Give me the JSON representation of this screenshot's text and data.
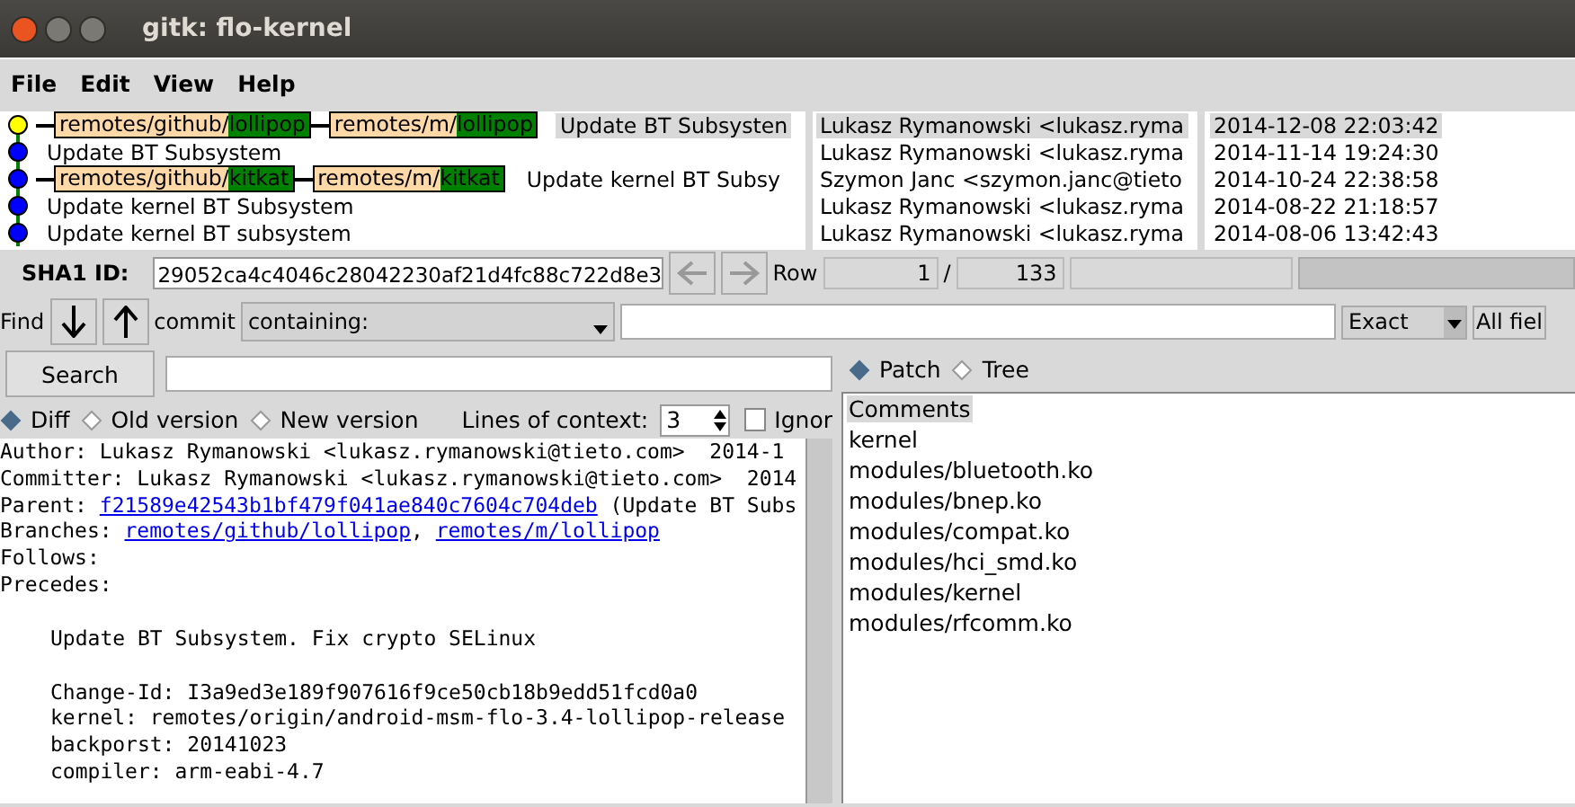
{
  "window": {
    "title": "gitk: flo-kernel"
  },
  "menu": [
    "File",
    "Edit",
    "View",
    "Help"
  ],
  "commits": [
    {
      "selected": true,
      "color": "#ffff00",
      "refs": [
        {
          "prefix": "remotes/github/",
          "name": "lollipop"
        },
        {
          "prefix": "remotes/m/",
          "name": "lollipop"
        }
      ],
      "subject": "Update BT Subsysten",
      "author": "Lukasz Rymanowski <lukasz.ryma",
      "date": "2014-12-08 22:03:42"
    },
    {
      "selected": false,
      "color": "#0000ff",
      "subject": "Update BT Subsystem",
      "author": "Lukasz Rymanowski <lukasz.ryma",
      "date": "2014-11-14 19:24:30"
    },
    {
      "selected": false,
      "color": "#0000ff",
      "refs": [
        {
          "prefix": "remotes/github/",
          "name": "kitkat"
        },
        {
          "prefix": "remotes/m/",
          "name": "kitkat"
        }
      ],
      "subject": "Update kernel BT Subsy",
      "author": "Szymon Janc <szymon.janc@tieto",
      "date": "2014-10-24 22:38:58"
    },
    {
      "selected": false,
      "color": "#0000ff",
      "subject": "Update kernel BT Subsystem",
      "author": "Lukasz Rymanowski <lukasz.ryma",
      "date": "2014-08-22 21:18:57"
    },
    {
      "selected": false,
      "color": "#0000ff",
      "subject": "Update kernel BT subsystem",
      "author": "Lukasz Rymanowski <lukasz.ryma",
      "date": "2014-08-06 13:42:43"
    }
  ],
  "sha1": {
    "label": "SHA1 ID:",
    "value": "29052ca4c4046c28042230af21d4fc88c722d8e3",
    "row_label": "Row",
    "row": "1",
    "separator": "/",
    "total": "133"
  },
  "find": {
    "label": "Find",
    "type_label": "commit",
    "mode": "containing:",
    "match": "Exact",
    "fields": "All fiel"
  },
  "search": {
    "button": "Search"
  },
  "view_modes": [
    {
      "label": "Diff",
      "selected": true
    },
    {
      "label": "Old version",
      "selected": false
    },
    {
      "label": "New version",
      "selected": false
    }
  ],
  "context": {
    "label": "Lines of context:",
    "value": "3"
  },
  "ignore": {
    "label": "Ignor",
    "checked": false
  },
  "file_modes": [
    {
      "label": "Patch",
      "selected": true
    },
    {
      "label": "Tree",
      "selected": false
    }
  ],
  "header": [
    [
      {
        "kind": "text",
        "text": "Author: Lukasz Rymanowski <lukasz.rymanowski@tieto.com>  2014-1"
      }
    ],
    [
      {
        "kind": "text",
        "text": "Committer: Lukasz Rymanowski <lukasz.rymanowski@tieto.com>  2014"
      }
    ],
    [
      {
        "kind": "text",
        "text": "Parent: "
      },
      {
        "kind": "link",
        "text": "f21589e42543b1bf479f041ae840c7604c704deb"
      },
      {
        "kind": "text",
        "text": " (Update BT Subs"
      }
    ],
    [
      {
        "kind": "text",
        "text": "Branches: "
      },
      {
        "kind": "link",
        "text": "remotes/github/lollipop"
      },
      {
        "kind": "text",
        "text": ", "
      },
      {
        "kind": "link",
        "text": "remotes/m/lollipop"
      }
    ],
    [
      {
        "kind": "text",
        "text": "Follows:"
      }
    ],
    [
      {
        "kind": "text",
        "text": "Precedes:"
      }
    ]
  ],
  "message": {
    "title": "Update BT Subsystem. Fix crypto SELinux",
    "body": [
      "Change-Id: I3a9ed3e189f907616f9ce50cb18b9edd51fcd0a0",
      "kernel: remotes/origin/android-msm-flo-3.4-lollipop-release",
      "backporst: 20141023",
      "compiler: arm-eabi-4.7"
    ]
  },
  "files": [
    {
      "name": "Comments",
      "selected": true
    },
    {
      "name": "kernel",
      "selected": false
    },
    {
      "name": "modules/bluetooth.ko",
      "selected": false
    },
    {
      "name": "modules/bnep.ko",
      "selected": false
    },
    {
      "name": "modules/compat.ko",
      "selected": false
    },
    {
      "name": "modules/hci_smd.ko",
      "selected": false
    },
    {
      "name": "modules/kernel",
      "selected": false
    },
    {
      "name": "modules/rfcomm.ko",
      "selected": false
    }
  ]
}
